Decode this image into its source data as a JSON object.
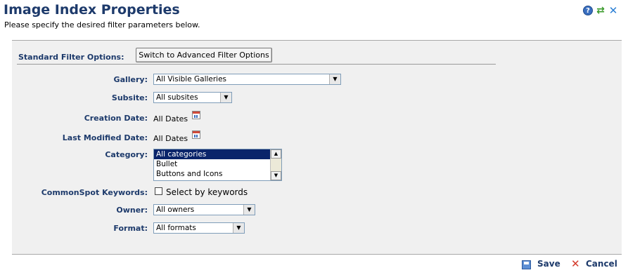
{
  "header": {
    "title": "Image Index Properties",
    "subtitle": "Please specify the desired filter parameters below.",
    "icons": [
      "help-icon",
      "refresh-icon",
      "close-icon"
    ]
  },
  "filter": {
    "standard_label": "Standard Filter Options:",
    "switch_button": "Switch to Advanced Filter Options",
    "gallery": {
      "label": "Gallery:",
      "value": "All Visible Galleries"
    },
    "subsite": {
      "label": "Subsite:",
      "value": "All subsites"
    },
    "creation_date": {
      "label": "Creation Date:",
      "value": "All Dates"
    },
    "last_modified_date": {
      "label": "Last Modified Date:",
      "value": "All Dates"
    },
    "category": {
      "label": "Category:",
      "options": [
        "All categories",
        "Bullet",
        "Buttons and Icons"
      ],
      "selected": "All categories"
    },
    "keywords": {
      "label": "CommonSpot Keywords:",
      "checkbox_label": "Select by keywords",
      "checked": false
    },
    "owner": {
      "label": "Owner:",
      "value": "All owners"
    },
    "format": {
      "label": "Format:",
      "value": "All formats"
    }
  },
  "footer": {
    "save_label": "Save",
    "cancel_label": "Cancel"
  },
  "colors": {
    "heading": "#1d3a6b",
    "panel_bg": "#f0f0f0",
    "selected_bg": "#0a246a"
  }
}
